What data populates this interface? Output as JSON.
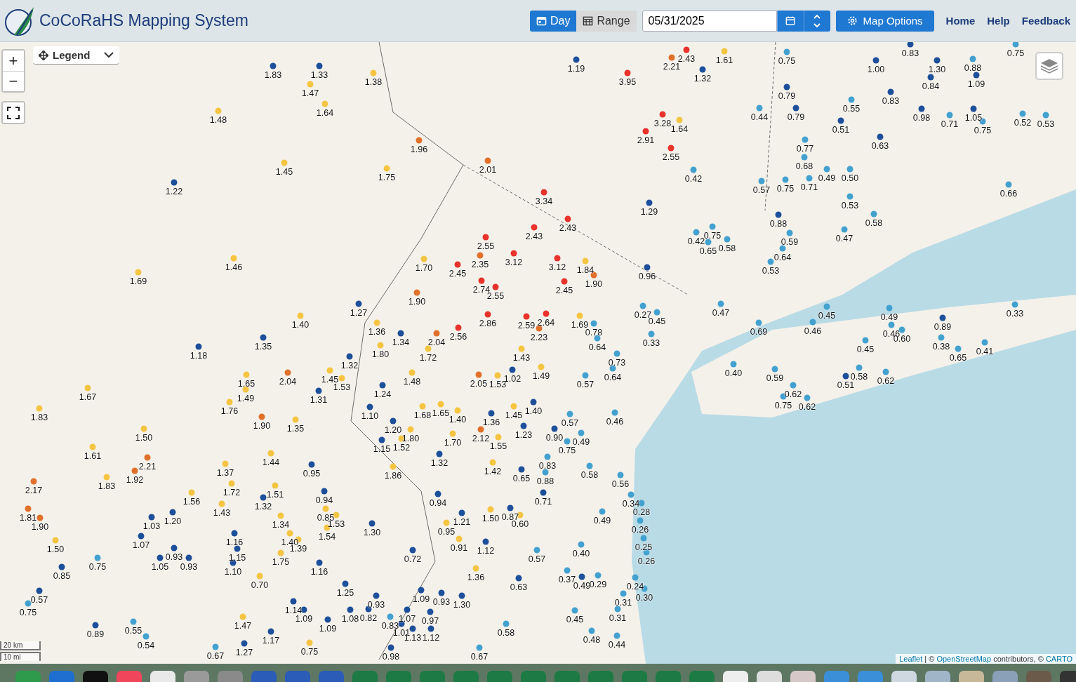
{
  "header": {
    "title": "CoCoRaHS Mapping System",
    "modes": [
      {
        "label": "Day",
        "kind": "day",
        "selected": true
      },
      {
        "label": "Range",
        "kind": "range",
        "selected": false
      }
    ],
    "date": {
      "value": "05/31/2025"
    },
    "map_options": "Map Options",
    "links": [
      "Home",
      "Help",
      "Feedback"
    ]
  },
  "map": {
    "zoom_in": "+",
    "zoom_out": "−",
    "legend": "Legend",
    "scale": [
      "20 km",
      "10 mi"
    ],
    "attribution": [
      {
        "text": "Leaflet",
        "link": true
      },
      {
        "text": "| ©",
        "link": false
      },
      {
        "text": "OpenStreetMap",
        "link": true
      },
      {
        "text": "contributors, ©",
        "link": false
      },
      {
        "text": "CARTO",
        "link": true
      }
    ],
    "markers": [
      {
        "value": "1.83",
        "color": "#1d4f9a"
      },
      {
        "value": "1.33",
        "color": "#1d4f9a"
      },
      {
        "value": "1.38",
        "color": "#f5c542"
      },
      {
        "value": "1.47",
        "color": "#f5c542"
      },
      {
        "value": "1.64",
        "color": "#f5c542"
      },
      {
        "value": "1.48",
        "color": "#f5c542"
      },
      {
        "value": "1.96",
        "color": "#e0702a"
      },
      {
        "value": "1.45",
        "color": "#f5c542"
      },
      {
        "value": "1.75",
        "color": "#f5c542"
      },
      {
        "value": "2.01",
        "color": "#e0702a"
      },
      {
        "value": "1.22",
        "color": "#1d4f9a"
      },
      {
        "value": "1.19",
        "color": "#1d4f9a"
      },
      {
        "value": "3.95",
        "color": "#e8322b"
      },
      {
        "value": "2.43",
        "color": "#e8322b"
      },
      {
        "value": "2.21",
        "color": "#e0702a"
      },
      {
        "value": "1.61",
        "color": "#f5c542"
      },
      {
        "value": "1.32",
        "color": "#1d4f9a"
      },
      {
        "value": "0.75",
        "color": "#43a1d0"
      },
      {
        "value": "1.00",
        "color": "#1d4f9a"
      },
      {
        "value": "1.30",
        "color": "#1d4f9a"
      },
      {
        "value": "0.88",
        "color": "#43a1d0"
      },
      {
        "value": "1.09",
        "color": "#1d4f9a"
      },
      {
        "value": "0.83",
        "color": "#1d4f9a"
      },
      {
        "value": "0.75",
        "color": "#43a1d0"
      },
      {
        "value": "0.84",
        "color": "#1d4f9a"
      },
      {
        "value": "0.79",
        "color": "#1d4f9a"
      },
      {
        "value": "0.83",
        "color": "#1d4f9a"
      },
      {
        "value": "3.28",
        "color": "#e8322b"
      },
      {
        "value": "1.64",
        "color": "#f5c542"
      },
      {
        "value": "0.44",
        "color": "#43a1d0"
      },
      {
        "value": "0.79",
        "color": "#1d4f9a"
      },
      {
        "value": "0.55",
        "color": "#43a1d0"
      },
      {
        "value": "0.51",
        "color": "#1d4f9a"
      },
      {
        "value": "0.98",
        "color": "#1d4f9a"
      },
      {
        "value": "0.71",
        "color": "#43a1d0"
      },
      {
        "value": "1.05",
        "color": "#1d4f9a"
      },
      {
        "value": "0.75",
        "color": "#43a1d0"
      },
      {
        "value": "0.52",
        "color": "#43a1d0"
      },
      {
        "value": "0.53",
        "color": "#43a1d0"
      },
      {
        "value": "2.91",
        "color": "#e8322b"
      },
      {
        "value": "2.55",
        "color": "#e8322b"
      },
      {
        "value": "0.77",
        "color": "#43a1d0"
      },
      {
        "value": "0.63",
        "color": "#1d4f9a"
      },
      {
        "value": "0.68",
        "color": "#43a1d0"
      },
      {
        "value": "0.49",
        "color": "#43a1d0"
      },
      {
        "value": "0.50",
        "color": "#43a1d0"
      },
      {
        "value": "0.71",
        "color": "#43a1d0"
      },
      {
        "value": "0.42",
        "color": "#43a1d0"
      },
      {
        "value": "0.57",
        "color": "#43a1d0"
      },
      {
        "value": "0.75",
        "color": "#43a1d0"
      },
      {
        "value": "0.66",
        "color": "#43a1d0"
      },
      {
        "value": "3.34",
        "color": "#e8322b"
      },
      {
        "value": "1.29",
        "color": "#1d4f9a"
      },
      {
        "value": "2.43",
        "color": "#e8322b"
      },
      {
        "value": "2.43",
        "color": "#e8322b"
      },
      {
        "value": "0.88",
        "color": "#1d4f9a"
      },
      {
        "value": "0.53",
        "color": "#43a1d0"
      },
      {
        "value": "0.58",
        "color": "#43a1d0"
      },
      {
        "value": "0.47",
        "color": "#43a1d0"
      },
      {
        "value": "0.42",
        "color": "#43a1d0"
      },
      {
        "value": "0.75",
        "color": "#43a1d0"
      },
      {
        "value": "0.65",
        "color": "#43a1d0"
      },
      {
        "value": "0.58",
        "color": "#43a1d0"
      },
      {
        "value": "0.59",
        "color": "#43a1d0"
      },
      {
        "value": "0.64",
        "color": "#43a1d0"
      },
      {
        "value": "0.53",
        "color": "#43a1d0"
      },
      {
        "value": "2.55",
        "color": "#e8322b"
      },
      {
        "value": "3.12",
        "color": "#e8322b"
      },
      {
        "value": "3.12",
        "color": "#e8322b"
      },
      {
        "value": "2.35",
        "color": "#e0702a"
      },
      {
        "value": "2.45",
        "color": "#e8322b"
      },
      {
        "value": "1.70",
        "color": "#f5c542"
      },
      {
        "value": "1.84",
        "color": "#f5c542"
      },
      {
        "value": "0.96",
        "color": "#1d4f9a"
      },
      {
        "value": "1.46",
        "color": "#f5c542"
      },
      {
        "value": "1.69",
        "color": "#f5c542"
      },
      {
        "value": "2.74",
        "color": "#e8322b"
      },
      {
        "value": "2.55",
        "color": "#e8322b"
      },
      {
        "value": "2.45",
        "color": "#e8322b"
      },
      {
        "value": "1.90",
        "color": "#e0702a"
      },
      {
        "value": "1.90",
        "color": "#e0702a"
      },
      {
        "value": "1.27",
        "color": "#1d4f9a"
      },
      {
        "value": "1.40",
        "color": "#f5c542"
      },
      {
        "value": "0.27",
        "color": "#43a1d0"
      },
      {
        "value": "0.45",
        "color": "#43a1d0"
      },
      {
        "value": "0.47",
        "color": "#43a1d0"
      },
      {
        "value": "1.36",
        "color": "#f5c542"
      },
      {
        "value": "1.34",
        "color": "#1d4f9a"
      },
      {
        "value": "2.04",
        "color": "#e0702a"
      },
      {
        "value": "2.56",
        "color": "#e8322b"
      },
      {
        "value": "2.86",
        "color": "#e8322b"
      },
      {
        "value": "2.59",
        "color": "#e8322b"
      },
      {
        "value": "2.64",
        "color": "#e8322b"
      },
      {
        "value": "2.23",
        "color": "#e0702a"
      },
      {
        "value": "1.69",
        "color": "#f5c542"
      },
      {
        "value": "0.78",
        "color": "#43a1d0"
      },
      {
        "value": "0.69",
        "color": "#43a1d0"
      },
      {
        "value": "0.45",
        "color": "#43a1d0"
      },
      {
        "value": "0.46",
        "color": "#43a1d0"
      },
      {
        "value": "0.49",
        "color": "#43a1d0"
      },
      {
        "value": "0.46",
        "color": "#43a1d0"
      },
      {
        "value": "0.60",
        "color": "#43a1d0"
      },
      {
        "value": "0.89",
        "color": "#1d4f9a"
      },
      {
        "value": "0.33",
        "color": "#43a1d0"
      },
      {
        "value": "1.35",
        "color": "#1d4f9a"
      },
      {
        "value": "1.18",
        "color": "#1d4f9a"
      },
      {
        "value": "1.80",
        "color": "#f5c542"
      },
      {
        "value": "1.72",
        "color": "#f5c542"
      },
      {
        "value": "1.43",
        "color": "#f5c542"
      },
      {
        "value": "0.64",
        "color": "#43a1d0"
      },
      {
        "value": "0.33",
        "color": "#43a1d0"
      },
      {
        "value": "0.45",
        "color": "#43a1d0"
      },
      {
        "value": "0.38",
        "color": "#43a1d0"
      },
      {
        "value": "0.65",
        "color": "#43a1d0"
      },
      {
        "value": "0.41",
        "color": "#43a1d0"
      },
      {
        "value": "1.32",
        "color": "#1d4f9a"
      },
      {
        "value": "0.73",
        "color": "#43a1d0"
      },
      {
        "value": "1.65",
        "color": "#f5c542"
      },
      {
        "value": "2.04",
        "color": "#e0702a"
      },
      {
        "value": "1.45",
        "color": "#f5c542"
      },
      {
        "value": "1.53",
        "color": "#f5c542"
      },
      {
        "value": "1.48",
        "color": "#f5c542"
      },
      {
        "value": "2.05",
        "color": "#e0702a"
      },
      {
        "value": "1.53",
        "color": "#f5c542"
      },
      {
        "value": "1.02",
        "color": "#1d4f9a"
      },
      {
        "value": "1.49",
        "color": "#f5c542"
      },
      {
        "value": "0.57",
        "color": "#43a1d0"
      },
      {
        "value": "0.64",
        "color": "#43a1d0"
      },
      {
        "value": "0.40",
        "color": "#43a1d0"
      },
      {
        "value": "0.59",
        "color": "#43a1d0"
      },
      {
        "value": "0.51",
        "color": "#1d4f9a"
      },
      {
        "value": "0.58",
        "color": "#43a1d0"
      },
      {
        "value": "0.62",
        "color": "#43a1d0"
      },
      {
        "value": "1.67",
        "color": "#f5c542"
      },
      {
        "value": "1.49",
        "color": "#f5c542"
      },
      {
        "value": "1.31",
        "color": "#1d4f9a"
      },
      {
        "value": "1.24",
        "color": "#1d4f9a"
      },
      {
        "value": "0.75",
        "color": "#43a1d0"
      },
      {
        "value": "0.62",
        "color": "#43a1d0"
      },
      {
        "value": "0.62",
        "color": "#43a1d0"
      },
      {
        "value": "1.83",
        "color": "#f5c542"
      },
      {
        "value": "1.76",
        "color": "#f5c542"
      },
      {
        "value": "1.90",
        "color": "#e0702a"
      },
      {
        "value": "1.35",
        "color": "#f5c542"
      },
      {
        "value": "1.10",
        "color": "#1d4f9a"
      },
      {
        "value": "1.68",
        "color": "#f5c542"
      },
      {
        "value": "1.65",
        "color": "#f5c542"
      },
      {
        "value": "1.40",
        "color": "#f5c542"
      },
      {
        "value": "1.45",
        "color": "#f5c542"
      },
      {
        "value": "1.40",
        "color": "#1d4f9a"
      },
      {
        "value": "1.36",
        "color": "#1d4f9a"
      },
      {
        "value": "0.57",
        "color": "#43a1d0"
      },
      {
        "value": "0.46",
        "color": "#43a1d0"
      },
      {
        "value": "1.50",
        "color": "#f5c542"
      },
      {
        "value": "1.20",
        "color": "#1d4f9a"
      },
      {
        "value": "1.15",
        "color": "#1d4f9a"
      },
      {
        "value": "1.52",
        "color": "#f5c542"
      },
      {
        "value": "1.80",
        "color": "#f5c542"
      },
      {
        "value": "1.70",
        "color": "#f5c542"
      },
      {
        "value": "2.12",
        "color": "#e0702a"
      },
      {
        "value": "1.23",
        "color": "#1d4f9a"
      },
      {
        "value": "0.90",
        "color": "#1d4f9a"
      },
      {
        "value": "0.75",
        "color": "#43a1d0"
      },
      {
        "value": "0.49",
        "color": "#43a1d0"
      },
      {
        "value": "1.61",
        "color": "#f5c542"
      },
      {
        "value": "2.21",
        "color": "#e0702a"
      },
      {
        "value": "1.44",
        "color": "#f5c542"
      },
      {
        "value": "1.32",
        "color": "#1d4f9a"
      },
      {
        "value": "1.55",
        "color": "#f5c542"
      },
      {
        "value": "0.83",
        "color": "#43a1d0"
      },
      {
        "value": "2.17",
        "color": "#e0702a"
      },
      {
        "value": "1.83",
        "color": "#f5c542"
      },
      {
        "value": "1.92",
        "color": "#e0702a"
      },
      {
        "value": "1.37",
        "color": "#f5c542"
      },
      {
        "value": "0.95",
        "color": "#1d4f9a"
      },
      {
        "value": "1.86",
        "color": "#f5c542"
      },
      {
        "value": "1.42",
        "color": "#f5c542"
      },
      {
        "value": "0.65",
        "color": "#1d4f9a"
      },
      {
        "value": "0.88",
        "color": "#43a1d0"
      },
      {
        "value": "0.58",
        "color": "#43a1d0"
      },
      {
        "value": "0.56",
        "color": "#43a1d0"
      },
      {
        "value": "1.56",
        "color": "#f5c542"
      },
      {
        "value": "1.72",
        "color": "#f5c542"
      },
      {
        "value": "1.32",
        "color": "#1d4f9a"
      },
      {
        "value": "1.51",
        "color": "#f5c542"
      },
      {
        "value": "0.94",
        "color": "#1d4f9a"
      },
      {
        "value": "0.94",
        "color": "#1d4f9a"
      },
      {
        "value": "0.71",
        "color": "#1d4f9a"
      },
      {
        "value": "0.34",
        "color": "#43a1d0"
      },
      {
        "value": "1.81",
        "color": "#e0702a"
      },
      {
        "value": "1.90",
        "color": "#e0702a"
      },
      {
        "value": "1.03",
        "color": "#1d4f9a"
      },
      {
        "value": "1.20",
        "color": "#1d4f9a"
      },
      {
        "value": "1.43",
        "color": "#f5c542"
      },
      {
        "value": "1.34",
        "color": "#f5c542"
      },
      {
        "value": "0.85",
        "color": "#f5c542"
      },
      {
        "value": "1.53",
        "color": "#f5c542"
      },
      {
        "value": "1.54",
        "color": "#f5c542"
      },
      {
        "value": "1.30",
        "color": "#1d4f9a"
      },
      {
        "value": "0.95",
        "color": "#f5c542"
      },
      {
        "value": "1.21",
        "color": "#1d4f9a"
      },
      {
        "value": "1.50",
        "color": "#f5c542"
      },
      {
        "value": "0.87",
        "color": "#1d4f9a"
      },
      {
        "value": "0.60",
        "color": "#f5c542"
      },
      {
        "value": "0.49",
        "color": "#43a1d0"
      },
      {
        "value": "0.28",
        "color": "#43a1d0"
      },
      {
        "value": "0.26",
        "color": "#43a1d0"
      },
      {
        "value": "1.50",
        "color": "#f5c542"
      },
      {
        "value": "1.07",
        "color": "#1d4f9a"
      },
      {
        "value": "1.16",
        "color": "#1d4f9a"
      },
      {
        "value": "1.40",
        "color": "#f5c542"
      },
      {
        "value": "1.39",
        "color": "#f5c542"
      },
      {
        "value": "0.91",
        "color": "#f5c542"
      },
      {
        "value": "1.12",
        "color": "#1d4f9a"
      },
      {
        "value": "0.40",
        "color": "#43a1d0"
      },
      {
        "value": "0.25",
        "color": "#43a1d0"
      },
      {
        "value": "0.75",
        "color": "#43a1d0"
      },
      {
        "value": "1.05",
        "color": "#1d4f9a"
      },
      {
        "value": "0.93",
        "color": "#1d4f9a"
      },
      {
        "value": "0.93",
        "color": "#1d4f9a"
      },
      {
        "value": "1.15",
        "color": "#1d4f9a"
      },
      {
        "value": "1.75",
        "color": "#f5c542"
      },
      {
        "value": "0.72",
        "color": "#1d4f9a"
      },
      {
        "value": "0.57",
        "color": "#43a1d0"
      },
      {
        "value": "0.26",
        "color": "#43a1d0"
      },
      {
        "value": "0.85",
        "color": "#1d4f9a"
      },
      {
        "value": "1.10",
        "color": "#1d4f9a"
      },
      {
        "value": "0.70",
        "color": "#f5c542"
      },
      {
        "value": "1.16",
        "color": "#1d4f9a"
      },
      {
        "value": "1.36",
        "color": "#f5c542"
      },
      {
        "value": "0.63",
        "color": "#1d4f9a"
      },
      {
        "value": "0.37",
        "color": "#43a1d0"
      },
      {
        "value": "0.49",
        "color": "#1d4f9a"
      },
      {
        "value": "0.29",
        "color": "#43a1d0"
      },
      {
        "value": "0.24",
        "color": "#43a1d0"
      },
      {
        "value": "0.57",
        "color": "#1d4f9a"
      },
      {
        "value": "1.25",
        "color": "#1d4f9a"
      },
      {
        "value": "0.93",
        "color": "#1d4f9a"
      },
      {
        "value": "1.09",
        "color": "#1d4f9a"
      },
      {
        "value": "0.93",
        "color": "#1d4f9a"
      },
      {
        "value": "1.30",
        "color": "#1d4f9a"
      },
      {
        "value": "0.31",
        "color": "#43a1d0"
      },
      {
        "value": "0.30",
        "color": "#43a1d0"
      },
      {
        "value": "0.75",
        "color": "#43a1d0"
      },
      {
        "value": "1.14",
        "color": "#1d4f9a"
      },
      {
        "value": "1.09",
        "color": "#1d4f9a"
      },
      {
        "value": "1.08",
        "color": "#1d4f9a"
      },
      {
        "value": "0.82",
        "color": "#1d4f9a"
      },
      {
        "value": "1.07",
        "color": "#1d4f9a"
      },
      {
        "value": "0.97",
        "color": "#1d4f9a"
      },
      {
        "value": "0.45",
        "color": "#43a1d0"
      },
      {
        "value": "0.31",
        "color": "#43a1d0"
      },
      {
        "value": "0.89",
        "color": "#1d4f9a"
      },
      {
        "value": "0.55",
        "color": "#43a1d0"
      },
      {
        "value": "1.47",
        "color": "#f5c542"
      },
      {
        "value": "1.17",
        "color": "#1d4f9a"
      },
      {
        "value": "1.09",
        "color": "#1d4f9a"
      },
      {
        "value": "0.83",
        "color": "#43a1d0"
      },
      {
        "value": "1.01",
        "color": "#1d4f9a"
      },
      {
        "value": "1.13",
        "color": "#1d4f9a"
      },
      {
        "value": "1.12",
        "color": "#1d4f9a"
      },
      {
        "value": "0.58",
        "color": "#43a1d0"
      },
      {
        "value": "0.54",
        "color": "#43a1d0"
      },
      {
        "value": "0.48",
        "color": "#43a1d0"
      },
      {
        "value": "0.44",
        "color": "#43a1d0"
      },
      {
        "value": "0.67",
        "color": "#43a1d0"
      },
      {
        "value": "1.27",
        "color": "#1d4f9a"
      },
      {
        "value": "0.75",
        "color": "#f5c542"
      },
      {
        "value": "0.98",
        "color": "#1d4f9a"
      },
      {
        "value": "0.67",
        "color": "#43a1d0"
      }
    ]
  }
}
